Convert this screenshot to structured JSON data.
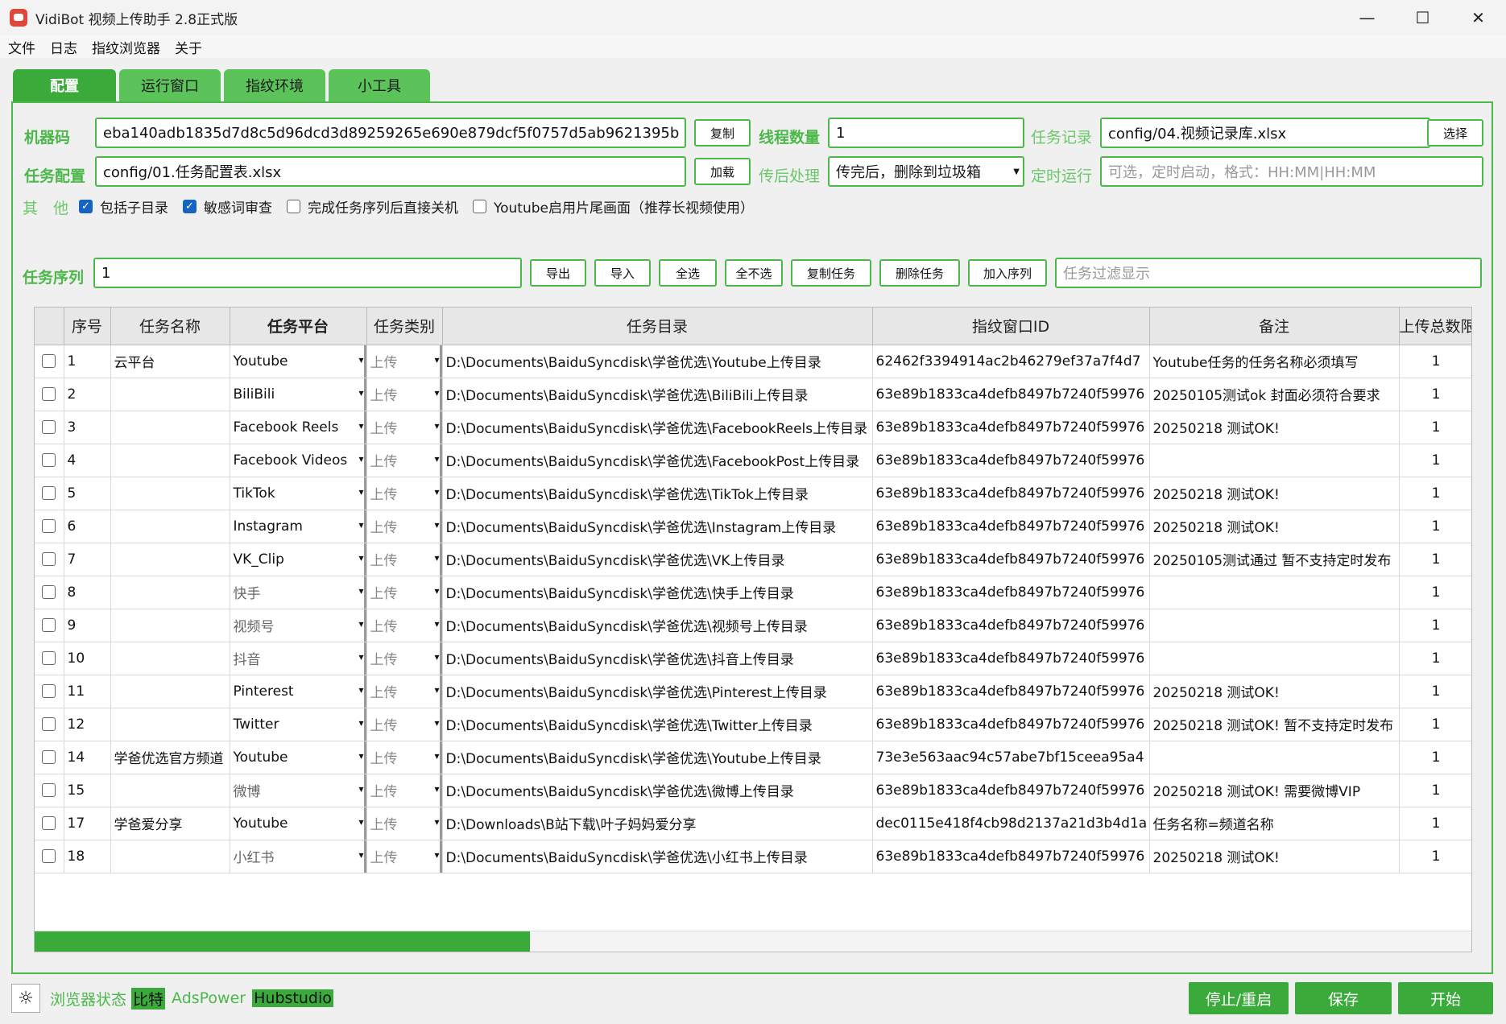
{
  "window": {
    "title": "VidiBot 视频上传助手 2.8正式版",
    "controls": [
      "—",
      "☐",
      "✕"
    ]
  },
  "menu": [
    "文件",
    "日志",
    "指纹浏览器",
    "关于"
  ],
  "tabs": [
    "配置",
    "运行窗口",
    "指纹环境",
    "小工具"
  ],
  "config": {
    "machine_code_label": "机器码",
    "machine_code": "eba140adb1835d7d8c5d96dcd3d89259265e690e879dcf5f0757d5ab9621395b",
    "copy_button": "复制",
    "thread_label": "线程数量",
    "thread_value": "1",
    "record_label": "任务记录",
    "record_value": "config/04.视频记录库.xlsx",
    "choose_button": "选择",
    "task_config_label": "任务配置",
    "task_config_value": "config/01.任务配置表.xlsx",
    "load_button": "加载",
    "post_label": "传后处理",
    "post_value": "传完后，删除到垃圾箱",
    "schedule_label": "定时运行",
    "schedule_placeholder": "可选，定时启动，格式：HH:MM|HH:MM",
    "other_label": "其　他",
    "checkboxes": [
      {
        "label": "包括子目录",
        "checked": true
      },
      {
        "label": "敏感词审查",
        "checked": true
      },
      {
        "label": "完成任务序列后直接关机",
        "checked": false
      },
      {
        "label": "Youtube启用片尾画面（推荐长视频使用）",
        "checked": false
      }
    ],
    "sequence_label": "任务序列",
    "sequence_value": "1",
    "buttons": [
      "导出",
      "导入",
      "全选",
      "全不选",
      "复制任务",
      "删除任务",
      "加入序列"
    ],
    "filter_placeholder": "任务过滤显示"
  },
  "table": {
    "headers": [
      "",
      "序号",
      "任务名称",
      "任务平台",
      "任务类别",
      "任务目录",
      "指纹窗口ID",
      "备注",
      "上传总数限"
    ],
    "rows": [
      {
        "no": "1",
        "name": "云平台",
        "platform": "Youtube",
        "cat": "上传",
        "dir": "D:\\Documents\\BaiduSyncdisk\\学爸优选\\Youtube上传目录",
        "fid": "62462f3394914ac2b46279ef37a7f4d7",
        "note": "Youtube任务的任务名称必须填写",
        "total": "1",
        "cn": false
      },
      {
        "no": "2",
        "name": "",
        "platform": "BiliBili",
        "cat": "上传",
        "dir": "D:\\Documents\\BaiduSyncdisk\\学爸优选\\BiliBili上传目录",
        "fid": "63e89b1833ca4defb8497b7240f59976",
        "note": "20250105测试ok 封面必须符合要求",
        "total": "1",
        "cn": false
      },
      {
        "no": "3",
        "name": "",
        "platform": "Facebook Reels",
        "cat": "上传",
        "dir": "D:\\Documents\\BaiduSyncdisk\\学爸优选\\FacebookReels上传目录",
        "fid": "63e89b1833ca4defb8497b7240f59976",
        "note": "20250218 测试OK!",
        "total": "1",
        "cn": false
      },
      {
        "no": "4",
        "name": "",
        "platform": "Facebook Videos",
        "cat": "上传",
        "dir": "D:\\Documents\\BaiduSyncdisk\\学爸优选\\FacebookPost上传目录",
        "fid": "63e89b1833ca4defb8497b7240f59976",
        "note": "",
        "total": "1",
        "cn": false
      },
      {
        "no": "5",
        "name": "",
        "platform": "TikTok",
        "cat": "上传",
        "dir": "D:\\Documents\\BaiduSyncdisk\\学爸优选\\TikTok上传目录",
        "fid": "63e89b1833ca4defb8497b7240f59976",
        "note": "20250218 测试OK!",
        "total": "1",
        "cn": false
      },
      {
        "no": "6",
        "name": "",
        "platform": "Instagram",
        "cat": "上传",
        "dir": "D:\\Documents\\BaiduSyncdisk\\学爸优选\\Instagram上传目录",
        "fid": "63e89b1833ca4defb8497b7240f59976",
        "note": "20250218 测试OK!",
        "total": "1",
        "cn": false
      },
      {
        "no": "7",
        "name": "",
        "platform": "VK_Clip",
        "cat": "上传",
        "dir": "D:\\Documents\\BaiduSyncdisk\\学爸优选\\VK上传目录",
        "fid": "63e89b1833ca4defb8497b7240f59976",
        "note": "20250105测试通过 暂不支持定时发布",
        "total": "1",
        "cn": false
      },
      {
        "no": "8",
        "name": "",
        "platform": "快手",
        "cat": "上传",
        "dir": "D:\\Documents\\BaiduSyncdisk\\学爸优选\\快手上传目录",
        "fid": "63e89b1833ca4defb8497b7240f59976",
        "note": "",
        "total": "1",
        "cn": true
      },
      {
        "no": "9",
        "name": "",
        "platform": "视频号",
        "cat": "上传",
        "dir": "D:\\Documents\\BaiduSyncdisk\\学爸优选\\视频号上传目录",
        "fid": "63e89b1833ca4defb8497b7240f59976",
        "note": "",
        "total": "1",
        "cn": true
      },
      {
        "no": "10",
        "name": "",
        "platform": "抖音",
        "cat": "上传",
        "dir": "D:\\Documents\\BaiduSyncdisk\\学爸优选\\抖音上传目录",
        "fid": "63e89b1833ca4defb8497b7240f59976",
        "note": "",
        "total": "1",
        "cn": true
      },
      {
        "no": "11",
        "name": "",
        "platform": "Pinterest",
        "cat": "上传",
        "dir": "D:\\Documents\\BaiduSyncdisk\\学爸优选\\Pinterest上传目录",
        "fid": "63e89b1833ca4defb8497b7240f59976",
        "note": "20250218 测试OK!",
        "total": "1",
        "cn": false
      },
      {
        "no": "12",
        "name": "",
        "platform": "Twitter",
        "cat": "上传",
        "dir": "D:\\Documents\\BaiduSyncdisk\\学爸优选\\Twitter上传目录",
        "fid": "63e89b1833ca4defb8497b7240f59976",
        "note": "20250218 测试OK! 暂不支持定时发布",
        "total": "1",
        "cn": false
      },
      {
        "no": "14",
        "name": "学爸优选官方频道",
        "platform": "Youtube",
        "cat": "上传",
        "dir": "D:\\Documents\\BaiduSyncdisk\\学爸优选\\Youtube上传目录",
        "fid": "73e3e563aac94c57abe7bf15ceea95a4",
        "note": "",
        "total": "1",
        "cn": false
      },
      {
        "no": "15",
        "name": "",
        "platform": "微博",
        "cat": "上传",
        "dir": "D:\\Documents\\BaiduSyncdisk\\学爸优选\\微博上传目录",
        "fid": "63e89b1833ca4defb8497b7240f59976",
        "note": "20250218 测试OK! 需要微博VIP",
        "total": "1",
        "cn": true
      },
      {
        "no": "17",
        "name": "学爸爱分享",
        "platform": "Youtube",
        "cat": "上传",
        "dir": "D:\\Downloads\\B站下载\\叶子妈妈爱分享",
        "fid": "dec0115e418f4cb98d2137a21d3b4d1a",
        "note": "任务名称=频道名称",
        "total": "1",
        "cn": false
      },
      {
        "no": "18",
        "name": "",
        "platform": "小红书",
        "cat": "上传",
        "dir": "D:\\Documents\\BaiduSyncdisk\\学爸优选\\小红书上传目录",
        "fid": "63e89b1833ca4defb8497b7240f59976",
        "note": "20250218 测试OK!",
        "total": "1",
        "cn": true
      }
    ]
  },
  "footer": {
    "status_label": "浏览器状态",
    "brands": [
      "比特",
      "AdsPower",
      "Hubstudio"
    ],
    "stop_button": "停止/重启",
    "save_button": "保存",
    "start_button": "开始"
  }
}
